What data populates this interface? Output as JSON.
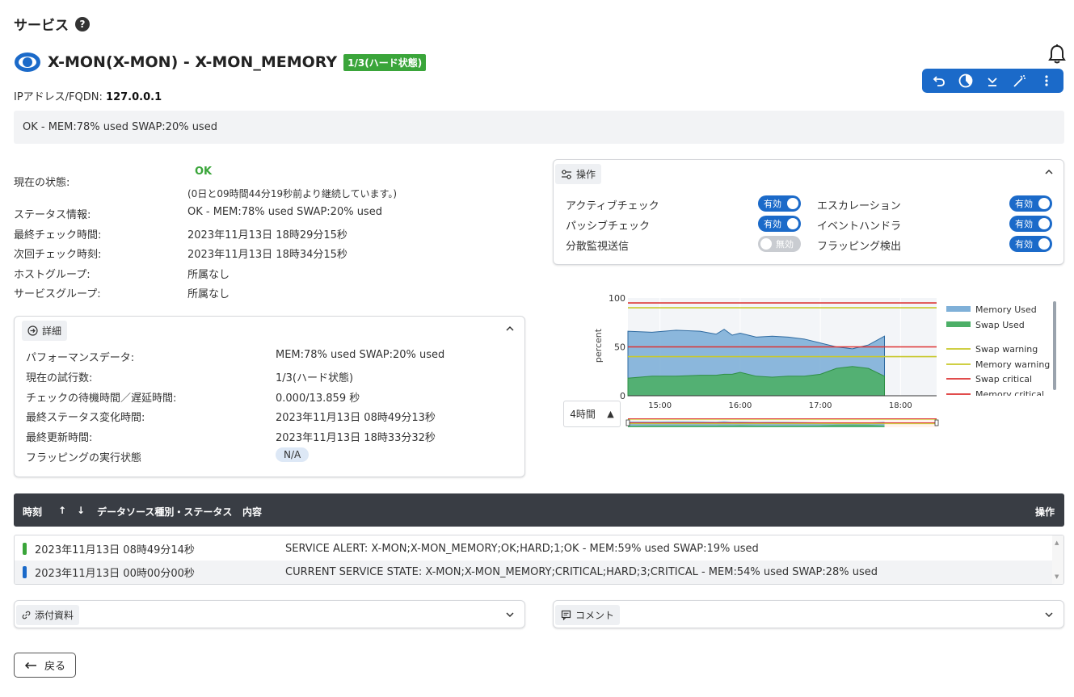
{
  "page": {
    "title": "サービス",
    "help": "?"
  },
  "service": {
    "name": "X-MON(X-MON) - X-MON_MEMORY",
    "badge": "1/3(ハード状態)",
    "ip_label": "IPアドレス/FQDN:",
    "ip_value": "127.0.0.1",
    "output": "OK - MEM:78% used SWAP:20% used"
  },
  "toolbar": {
    "icons": [
      "undo-icon",
      "pie-chart-icon",
      "download-icon",
      "wand-icon",
      "more-vert-icon"
    ]
  },
  "status_info": {
    "current_state_label": "現在の状態:",
    "current_state_value": "OK",
    "duration": "(0日と09時間44分19秒前より継続しています。)",
    "status_info_label": "ステータス情報:",
    "status_info_value": "OK - MEM:78% used SWAP:20% used",
    "last_check_label": "最終チェック時間:",
    "last_check_value": "2023年11月13日 18時29分15秒",
    "next_check_label": "次回チェック時刻:",
    "next_check_value": "2023年11月13日 18時34分15秒",
    "host_group_label": "ホストグループ:",
    "host_group_value": "所属なし",
    "service_group_label": "サービスグループ:",
    "service_group_value": "所属なし"
  },
  "details": {
    "tag": "詳細",
    "rows": [
      {
        "label": "パフォーマンスデータ:",
        "value": "MEM:78% used SWAP:20% used"
      },
      {
        "label": "現在の試行数:",
        "value": "1/3(ハード状態)"
      },
      {
        "label": "チェックの待機時間／遅延時間:",
        "value": "0.000/13.859 秒"
      },
      {
        "label": "最終ステータス変化時間:",
        "value": "2023年11月13日 08時49分13秒"
      },
      {
        "label": "最終更新時間:",
        "value": "2023年11月13日 18時33分32秒"
      },
      {
        "label": "フラッピングの実行状態",
        "value": "N/A"
      }
    ]
  },
  "operations": {
    "tag": "操作",
    "items": [
      {
        "label": "アクティブチェック",
        "state": "有効"
      },
      {
        "label": "パッシブチェック",
        "state": "有効"
      },
      {
        "label": "分散監視送信",
        "state": "無効"
      },
      {
        "label": "エスカレーション",
        "state": "有効"
      },
      {
        "label": "イベントハンドラ",
        "state": "有効"
      },
      {
        "label": "フラッピング検出",
        "state": "有効"
      }
    ]
  },
  "range_select": {
    "value": "4時間",
    "arrow": "▲"
  },
  "chart_data": {
    "type": "area",
    "ylabel": "percent",
    "ylim": [
      0,
      100
    ],
    "y_ticks": [
      "0",
      "50",
      "100"
    ],
    "x_ticks": [
      "15:00",
      "16:00",
      "17:00",
      "18:00"
    ],
    "x_hours": [
      14.6,
      14.9,
      15.2,
      15.5,
      15.7,
      15.8,
      15.9,
      16.0,
      16.2,
      16.4,
      16.6,
      16.8,
      17.0,
      17.2,
      17.4,
      17.6,
      17.8
    ],
    "series": [
      {
        "name": "Memory Used",
        "color": "#7fb0d8",
        "values": [
          66,
          65,
          67,
          66,
          63,
          68,
          62,
          64,
          60,
          61,
          60,
          58,
          54,
          50,
          48,
          52,
          61
        ]
      },
      {
        "name": "Swap Used",
        "color": "#4caf67",
        "values": [
          18,
          20,
          20,
          21,
          21,
          22,
          22,
          24,
          20,
          19,
          20,
          20,
          22,
          28,
          30,
          28,
          20
        ]
      }
    ],
    "thresholds": [
      {
        "name": "Swap warning",
        "color": "#c8c82a",
        "value": 90
      },
      {
        "name": "Memory warning",
        "color": "#c8c82a",
        "value": 40
      },
      {
        "name": "Swap critical",
        "color": "#dd3333",
        "value": 95
      },
      {
        "name": "Memory critical",
        "color": "#dd3333",
        "value": 50
      }
    ],
    "legend_placement": "right"
  },
  "log_table": {
    "headers": {
      "time": "時刻",
      "sort_up": "↑",
      "sort_down": "↓",
      "type": "データソース種別・ステータス",
      "content": "内容",
      "actions": "操作"
    },
    "rows": [
      {
        "time": "2023年11月13日 08時49分14秒",
        "content": "SERVICE ALERT: X-MON;X-MON_MEMORY;OK;HARD;1;OK - MEM:59% used SWAP:19% used",
        "color": "#3aa53a"
      },
      {
        "time": "2023年11月13日 00時00分00秒",
        "content": "CURRENT SERVICE STATE: X-MON;X-MON_MEMORY;CRITICAL;HARD;3;CRITICAL - MEM:54% used SWAP:28% used",
        "color": "#1b6ac9"
      }
    ]
  },
  "attachments": {
    "tag": "添付資料"
  },
  "comments": {
    "tag": "コメント"
  },
  "back": {
    "label": "戻る"
  }
}
